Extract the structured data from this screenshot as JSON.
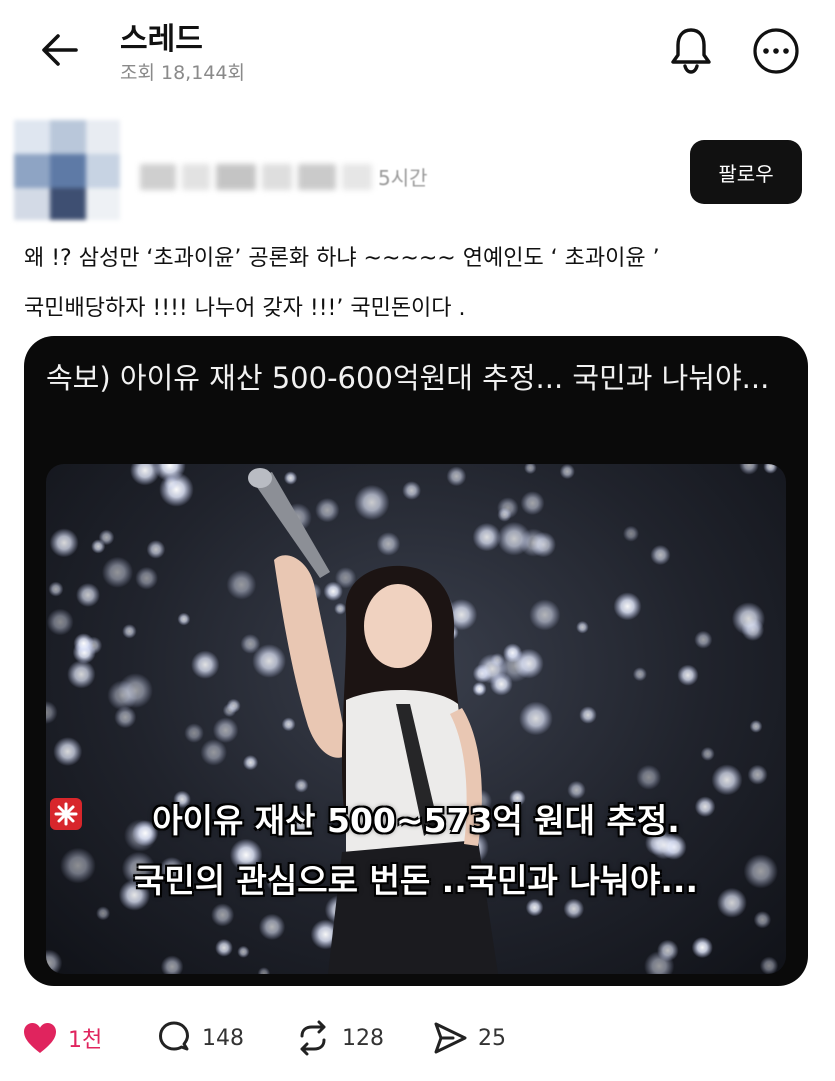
{
  "header": {
    "title": "스레드",
    "views": "조회 18,144회"
  },
  "author": {
    "time": "5시간",
    "follow_label": "팔로우"
  },
  "post": {
    "line1": "왜 !? 삼성만 ‘초과이윤’ 공론화 하냐 ~~~~~ 연예인도 ‘ 초과이윤 ’",
    "line2": "국민배당하자 !!!! 나누어 갖자 !!!’ 국민돈이다 ."
  },
  "card": {
    "title": "속보) 아이유 재산 500-600억원대 추정... 국민과 나눠야...",
    "caption1": "아이유 재산 500~573억 원대 추정.",
    "caption2": "국민의 관심으로 번돈 ..국민과 나눠야..."
  },
  "actions": {
    "likes": "1천",
    "comments": "148",
    "reposts": "128",
    "shares": "25"
  },
  "colors": {
    "like": "#e0245e",
    "follow_bg": "#111111",
    "card_bg": "#0a0a0a"
  },
  "icons": [
    "back-arrow-icon",
    "bell-icon",
    "more-icon",
    "heart-icon",
    "comment-icon",
    "repost-icon",
    "share-icon",
    "siren-icon"
  ]
}
